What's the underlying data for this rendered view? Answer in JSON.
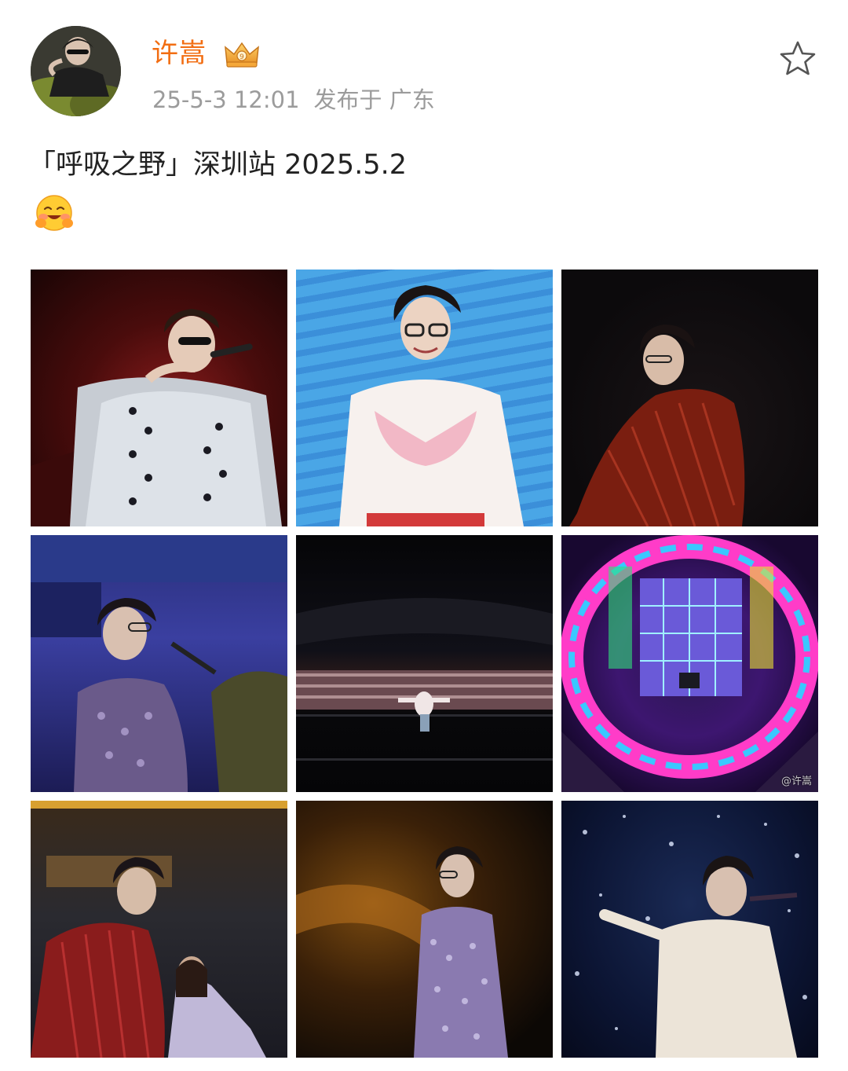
{
  "author": {
    "name": "许嵩",
    "badge_icon": "crown-badge-icon",
    "avatar_icon": "user-avatar"
  },
  "meta": {
    "time": "25-5-3 12:01",
    "location": "发布于 广东"
  },
  "post": {
    "text": "「呼吸之野」深圳站 2025.5.2",
    "emoji_icon": "hug-face-emoji"
  },
  "actions": {
    "favorite_icon": "star-icon"
  },
  "images": [
    {
      "id": "photo-1",
      "desc_icon": "singer-silver-shirt-photo"
    },
    {
      "id": "photo-2",
      "desc_icon": "singer-white-shirt-photo"
    },
    {
      "id": "photo-3",
      "desc_icon": "singer-red-velvet-photo"
    },
    {
      "id": "photo-4",
      "desc_icon": "singer-at-piano-photo"
    },
    {
      "id": "photo-5",
      "desc_icon": "stadium-crowd-photo"
    },
    {
      "id": "photo-6",
      "desc_icon": "stage-overhead-photo",
      "watermark": "@许嵩"
    },
    {
      "id": "photo-7",
      "desc_icon": "singer-with-child-photo"
    },
    {
      "id": "photo-8",
      "desc_icon": "singer-sequin-photo"
    },
    {
      "id": "photo-9",
      "desc_icon": "singer-snow-photo"
    }
  ],
  "colors": {
    "username": "#f26d12",
    "meta": "#9b9b9b",
    "text": "#222222"
  }
}
